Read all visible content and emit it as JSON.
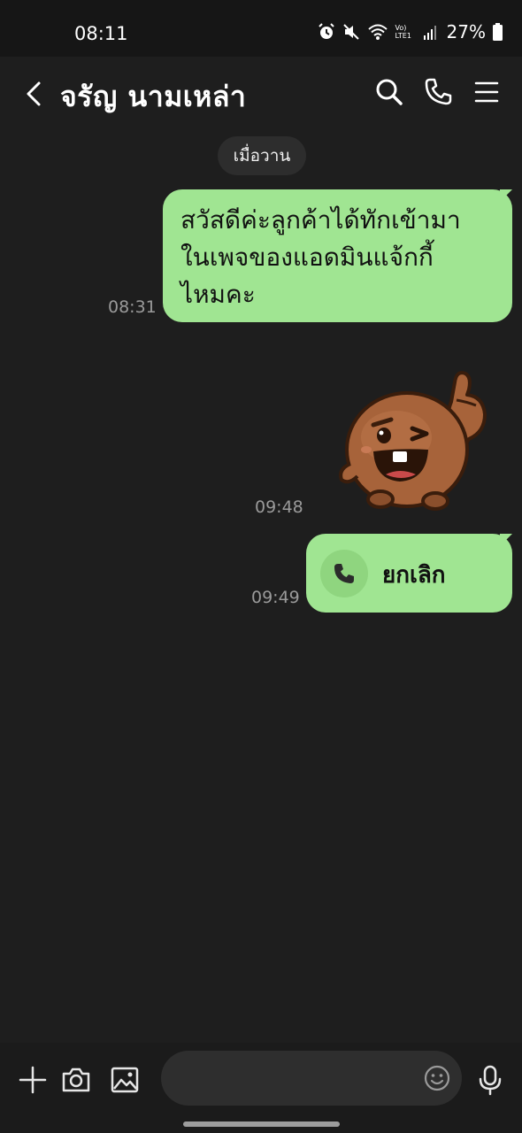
{
  "status_bar": {
    "time": "08:11",
    "network_label": "Vo) LTE1",
    "battery": "27%"
  },
  "header": {
    "title": "จรัญ  นามเหล่า"
  },
  "chat": {
    "date_label": "เมื่อวาน",
    "messages": [
      {
        "type": "text",
        "lines": [
          "สวัสดีค่ะลูกค้าได้ทักเข้ามา",
          "ในเพจของแอดมินแจ้กกี้",
          "ไหมคะ"
        ],
        "time": "08:31"
      },
      {
        "type": "sticker",
        "time": "09:48"
      },
      {
        "type": "call",
        "label": "ยกเลิก",
        "time": "09:49"
      }
    ]
  },
  "colors": {
    "background": "#1e1e1e",
    "bubble": "#a0e592",
    "statusbar": "#161616"
  },
  "icons": {
    "header": [
      "back-icon",
      "search-icon",
      "phone-icon",
      "menu-icon"
    ],
    "inputbar": [
      "plus-icon",
      "camera-icon",
      "image-icon",
      "emoji-icon",
      "mic-icon"
    ]
  }
}
